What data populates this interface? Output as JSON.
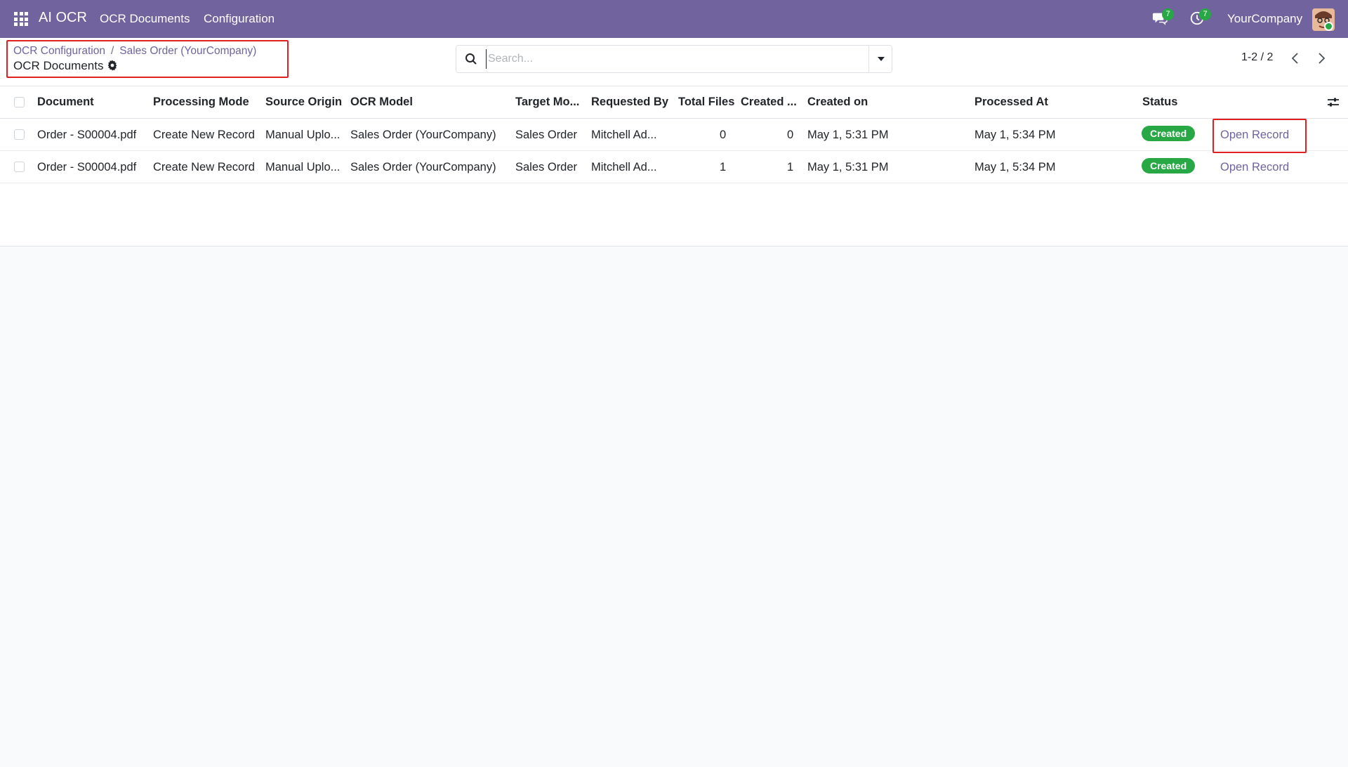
{
  "navbar": {
    "app_name": "AI OCR",
    "menu": [
      "OCR Documents",
      "Configuration"
    ],
    "messages_count": "7",
    "activities_count": "7",
    "company": "YourCompany"
  },
  "breadcrumb": {
    "parent1": "OCR Configuration",
    "separator": "/",
    "parent2": "Sales Order (YourCompany)",
    "current": "OCR Documents"
  },
  "search": {
    "placeholder": "Search..."
  },
  "pager": {
    "text": "1-2 / 2"
  },
  "table": {
    "columns": [
      "Document",
      "Processing Mode",
      "Source Origin",
      "OCR Model",
      "Target Mo...",
      "Requested By",
      "Total Files",
      "Created ...",
      "Created on",
      "Processed At",
      "Status"
    ],
    "rows": [
      {
        "document": "Order - S00004.pdf",
        "processing_mode": "Create New Record",
        "source_origin": "Manual Uplo...",
        "ocr_model": "Sales Order (YourCompany)",
        "target_model": "Sales Order",
        "requested_by": "Mitchell Ad...",
        "total_files": "0",
        "created_count": "0",
        "created_on": "May 1, 5:31 PM",
        "processed_at": "May 1, 5:34 PM",
        "status": "Created",
        "action": "Open Record"
      },
      {
        "document": "Order - S00004.pdf",
        "processing_mode": "Create New Record",
        "source_origin": "Manual Uplo...",
        "ocr_model": "Sales Order (YourCompany)",
        "target_model": "Sales Order",
        "requested_by": "Mitchell Ad...",
        "total_files": "1",
        "created_count": "1",
        "created_on": "May 1, 5:31 PM",
        "processed_at": "May 1, 5:34 PM",
        "status": "Created",
        "action": "Open Record"
      }
    ]
  },
  "colors": {
    "brand": "#71639e",
    "status_created": "#28a745",
    "highlight": "#e02020"
  }
}
